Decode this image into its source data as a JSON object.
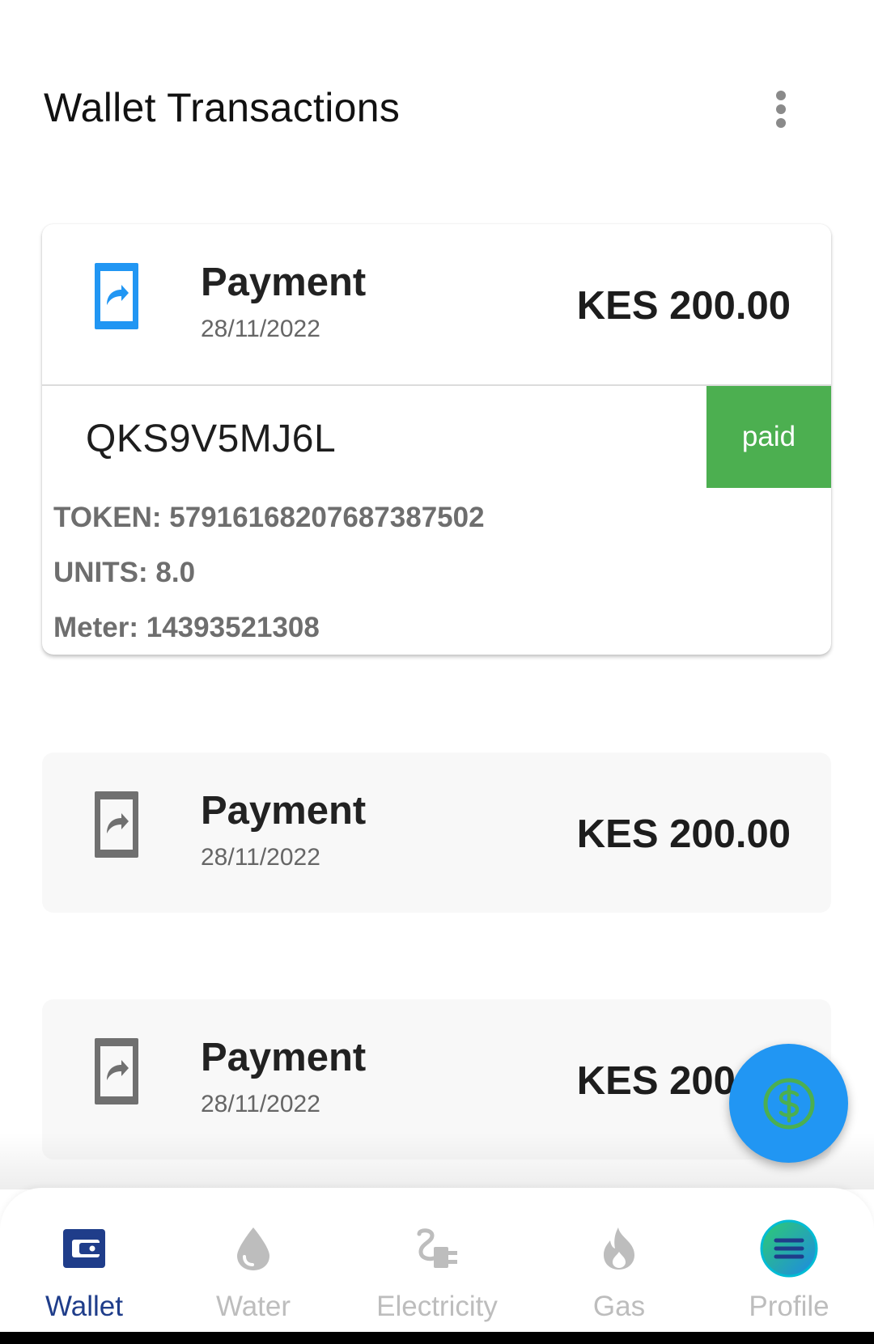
{
  "app_bar": {
    "title": "Wallet Transactions",
    "menu_icon": "more-vert-icon"
  },
  "transactions": [
    {
      "title": "Payment",
      "date": "28/11/2022",
      "amount": "KES 200.00",
      "reference": "QKS9V5MJ6L",
      "status": "paid",
      "token": "TOKEN: 57916168207687387502",
      "units": "UNITS: 8.0",
      "meter": "Meter: 14393521308",
      "icon": "send-icon",
      "icon_color": "#2196f3",
      "expanded": true
    },
    {
      "title": "Payment",
      "date": "28/11/2022",
      "amount": "KES 200.00",
      "icon": "send-icon",
      "icon_color": "#707070",
      "expanded": false
    },
    {
      "title": "Payment",
      "date": "28/11/2022",
      "amount": "KES 200.00",
      "icon": "send-icon",
      "icon_color": "#707070",
      "expanded": false
    }
  ],
  "fab": {
    "icon": "dollar-circle-icon",
    "color": "#2196f3",
    "icon_color": "#4caf50"
  },
  "bottom_nav": {
    "items": [
      {
        "label": "Wallet",
        "icon": "wallet-icon",
        "active": true
      },
      {
        "label": "Water",
        "icon": "water-drop-icon",
        "active": false
      },
      {
        "label": "Electricity",
        "icon": "electric-plug-icon",
        "active": false
      },
      {
        "label": "Gas",
        "icon": "flame-icon",
        "active": false
      },
      {
        "label": "Profile",
        "icon": "profile-menu-icon",
        "active": false
      }
    ],
    "active_color": "#1f3d8a",
    "inactive_color": "#bdbdbd"
  },
  "status_colors": {
    "paid": "#4caf50"
  }
}
